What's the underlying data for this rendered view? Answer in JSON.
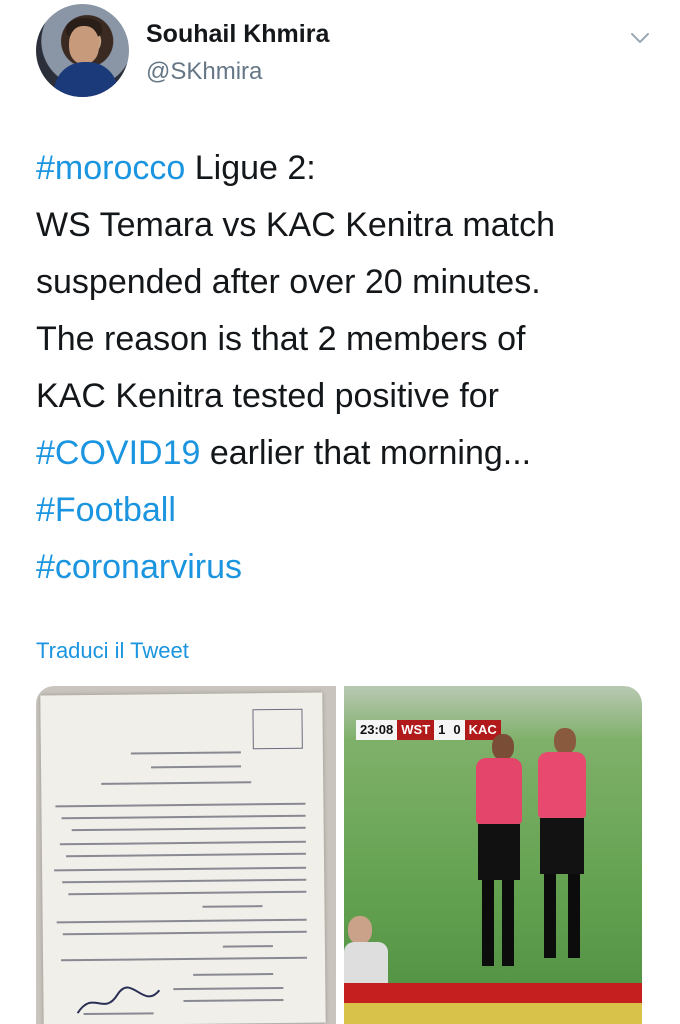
{
  "author": {
    "name": "Souhail Khmira",
    "handle": "@SKhmira"
  },
  "tweet": {
    "lines": [
      {
        "tag": "#morocco",
        "text": " Ligue 2:"
      },
      {
        "tag": "",
        "text": "WS Temara vs KAC Kenitra match"
      },
      {
        "tag": "",
        "text": "suspended after over 20 minutes."
      },
      {
        "tag": "",
        "text": "The reason is that 2 members of"
      },
      {
        "tag": "",
        "text": "KAC Kenitra tested positive for"
      },
      {
        "tag": "#COVID19",
        "text": " earlier that morning..."
      },
      {
        "tag": "#Football",
        "text": ""
      },
      {
        "tag": "#coronarvirus",
        "text": ""
      }
    ],
    "translate_label": "Traduci il Tweet"
  },
  "media": {
    "scoreboard": {
      "time": "23:08",
      "home": "WST",
      "home_score": "1",
      "away_score": "0",
      "away": "KAC"
    }
  },
  "colors": {
    "link": "#1b95e0",
    "text": "#14171a",
    "secondary": "#657786"
  },
  "icons": {
    "menu": "chevron-down-icon"
  }
}
